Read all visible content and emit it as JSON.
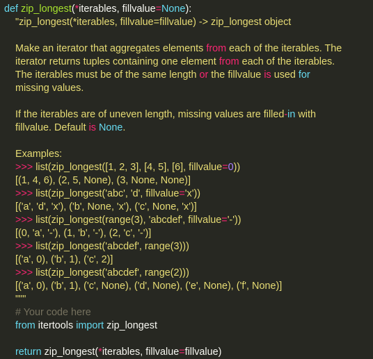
{
  "colors": {
    "background": "#272822",
    "default": "#f8f8f2",
    "keyword": "#66d9ef",
    "function": "#a6e22e",
    "string": "#e6db74",
    "operator": "#f92672",
    "number": "#ae81ff",
    "constant": "#ae81ff",
    "comment": "#75715e"
  },
  "code": {
    "lines": [
      [
        [
          "kw",
          "def"
        ],
        [
          "id",
          " "
        ],
        [
          "fn",
          "zip_longest"
        ],
        [
          "id",
          "("
        ],
        [
          "op",
          "*"
        ],
        [
          "id",
          "iterables, fillvalue"
        ],
        [
          "op",
          "="
        ],
        [
          "kw",
          "None"
        ],
        [
          "id",
          "):"
        ]
      ],
      [
        [
          "str",
          "    \"zip_longest(*iterables, fillvalue=fillvalue) -> zip_longest object"
        ]
      ],
      [
        [
          "str",
          ""
        ]
      ],
      [
        [
          "str",
          "    Make an iterator that aggregates elements "
        ],
        [
          "op",
          "from"
        ],
        [
          "str",
          " each of the iterables. The"
        ]
      ],
      [
        [
          "str",
          "    iterator returns tuples containing one element "
        ],
        [
          "op",
          "from"
        ],
        [
          "str",
          " each of the iterables."
        ]
      ],
      [
        [
          "str",
          "    The iterables must be of the same length "
        ],
        [
          "op",
          "or"
        ],
        [
          "str",
          " the fillvalue "
        ],
        [
          "op",
          "is"
        ],
        [
          "str",
          " used "
        ],
        [
          "kw",
          "for"
        ]
      ],
      [
        [
          "str",
          "    missing values."
        ]
      ],
      [
        [
          "str",
          ""
        ]
      ],
      [
        [
          "str",
          "    If the iterables are of uneven length, missing values are filled"
        ],
        [
          "op",
          "-"
        ],
        [
          "kw",
          "in"
        ],
        [
          "str",
          " with"
        ]
      ],
      [
        [
          "str",
          "    fillvalue. Default "
        ],
        [
          "op",
          "is"
        ],
        [
          "str",
          " "
        ],
        [
          "kw",
          "None"
        ],
        [
          "str",
          "."
        ]
      ],
      [
        [
          "str",
          ""
        ]
      ],
      [
        [
          "str",
          "    Examples:"
        ]
      ],
      [
        [
          "str",
          "    "
        ],
        [
          "op",
          ">>>"
        ],
        [
          "str",
          " list(zip_longest([1, 2, 3], [4, 5], [6], fillvalue"
        ],
        [
          "op",
          "="
        ],
        [
          "num",
          "0"
        ],
        [
          "str",
          "))"
        ]
      ],
      [
        [
          "str",
          "    [(1, 4, 6), (2, 5, None), (3, None, None)]"
        ]
      ],
      [
        [
          "str",
          "    "
        ],
        [
          "op",
          ">>>"
        ],
        [
          "str",
          " list(zip_longest('abc', 'd', fillvalue"
        ],
        [
          "op",
          "="
        ],
        [
          "str",
          "'x'))"
        ]
      ],
      [
        [
          "str",
          "    [('a', 'd', 'x'), ('b', None, 'x'), ('c', None, 'x')]"
        ]
      ],
      [
        [
          "str",
          "    "
        ],
        [
          "op",
          ">>>"
        ],
        [
          "str",
          " list(zip_longest(range(3), 'abcdef', fillvalue"
        ],
        [
          "op",
          "="
        ],
        [
          "str",
          "'-'))"
        ]
      ],
      [
        [
          "str",
          "    [(0, 'a', '-'), (1, 'b', '-'), (2, 'c', '-')]"
        ]
      ],
      [
        [
          "str",
          "    "
        ],
        [
          "op",
          ">>>"
        ],
        [
          "str",
          " list(zip_longest('abcdef', range(3)))"
        ]
      ],
      [
        [
          "str",
          "    [('a', 0), ('b', 1), ('c', 2)]"
        ]
      ],
      [
        [
          "str",
          "    "
        ],
        [
          "op",
          ">>>"
        ],
        [
          "str",
          " list(zip_longest('abcdef', range(2)))"
        ]
      ],
      [
        [
          "str",
          "    [('a', 0), ('b', 1), ('c', None), ('d', None), ('e', None), ('f', None)]"
        ]
      ],
      [
        [
          "str",
          "    \"\"\""
        ]
      ],
      [
        [
          "cm",
          "    # Your code here"
        ]
      ],
      [
        [
          "id",
          "    "
        ],
        [
          "kw",
          "from"
        ],
        [
          "id",
          " itertools "
        ],
        [
          "kw",
          "import"
        ],
        [
          "id",
          " zip_longest"
        ]
      ],
      [
        [
          "id",
          ""
        ]
      ],
      [
        [
          "id",
          "    "
        ],
        [
          "kw",
          "return"
        ],
        [
          "id",
          " zip_longest("
        ],
        [
          "op",
          "*"
        ],
        [
          "id",
          "iterables, fillvalue"
        ],
        [
          "op",
          "="
        ],
        [
          "id",
          "fillvalue)"
        ]
      ]
    ]
  }
}
